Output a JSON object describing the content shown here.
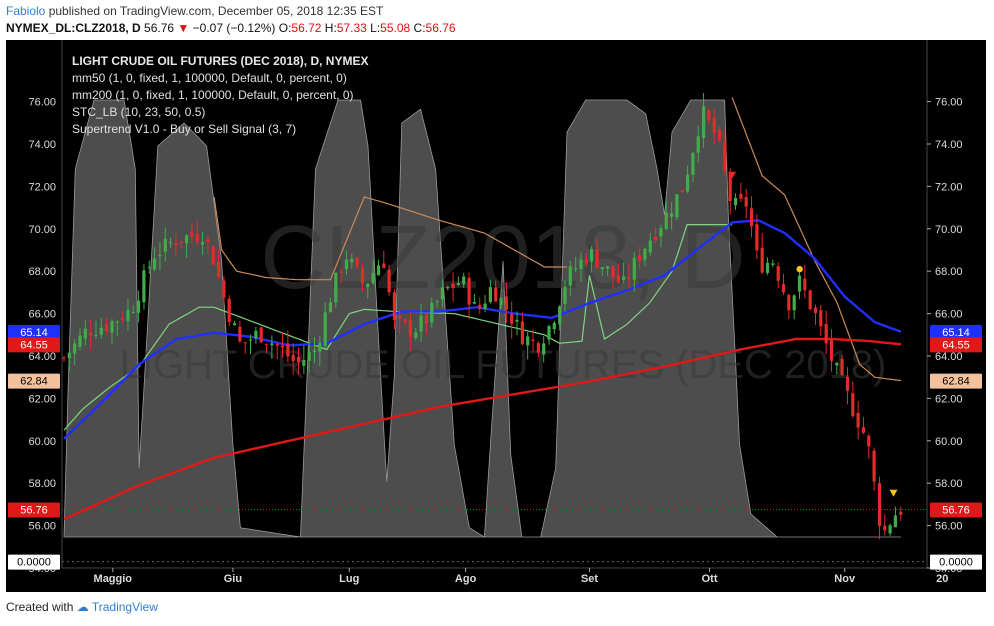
{
  "header": {
    "author": "Fabiolo",
    "published": "published on TradingView.com, December 05, 2018 12:35 EST",
    "symbol": "NYMEX_DL:CLZ2018, D",
    "last": "56.76",
    "change": "−0.07 (−0.12%)",
    "open_label": "O:",
    "open": "56.72",
    "high_label": "H:",
    "high": "57.33",
    "low_label": "L:",
    "low": "55.08",
    "close_label": "C:",
    "close": "56.76"
  },
  "legend": {
    "title": "LIGHT CRUDE OIL FUTURES (DEC 2018), D, NYMEX",
    "line1": "mm50 (1, 0, fixed, 1, 100000, Default, 0, percent, 0)",
    "line2": "mm200 (1, 0, fixed, 1, 100000, Default, 0, percent, 0)",
    "line3": "STC_LB (10, 23, 50, 0.5)",
    "line4": "Supertrend V1.0 - Buy or Sell Signal (3, 7)"
  },
  "watermark": {
    "symbol": "CLZ2018, D",
    "name": "LIGHT CRUDE OIL FUTURES (DEC 2018)"
  },
  "footer": {
    "created_with": "Created with",
    "brand": "TradingView"
  },
  "colors": {
    "background": "#000000",
    "up_candle": "#3fae49",
    "down_candle": "#e8292c",
    "mm50": "#1f2fff",
    "mm200": "#e01818",
    "stc_fill": "#555555",
    "supertrend_up": "#7fd47f",
    "supertrend_down": "#c98a5a"
  },
  "chart_data": {
    "type": "candlestick",
    "y_range": [
      54,
      77
    ],
    "y_ticks": [
      "54.00",
      "56.00",
      "58.00",
      "60.00",
      "62.00",
      "64.00",
      "66.00",
      "68.00",
      "70.00",
      "72.00",
      "74.00",
      "76.00"
    ],
    "x_labels": [
      "Maggio",
      "Giu",
      "Lug",
      "Ago",
      "Set",
      "Ott",
      "Nov",
      "20"
    ],
    "x_label_days": [
      13,
      45,
      76,
      107,
      140,
      172,
      208,
      234
    ],
    "price_labels": {
      "left": [
        {
          "text": "65.14",
          "value": 65.14,
          "color": "#1f2fff"
        },
        {
          "text": "64.55",
          "value": 64.55,
          "color": "#e01818"
        },
        {
          "text": "62.84",
          "value": 62.84,
          "color": "#f3c29c"
        },
        {
          "text": "56.76",
          "value": 56.76,
          "color": "#e01818"
        },
        {
          "text": "0.0000",
          "value": 54.3,
          "color": "#ffffff"
        }
      ],
      "right": [
        {
          "text": "65.14",
          "value": 65.14,
          "color": "#1f2fff"
        },
        {
          "text": "64.55",
          "value": 64.55,
          "color": "#e01818"
        },
        {
          "text": "62.84",
          "value": 62.84,
          "color": "#f3c29c"
        },
        {
          "text": "56.76",
          "value": 56.76,
          "color": "#e01818"
        },
        {
          "text": "0.0000",
          "value": 54.3,
          "color": "#ffffff"
        }
      ]
    },
    "close_key": [
      [
        0,
        63.9
      ],
      [
        6,
        65.2
      ],
      [
        12,
        65.5
      ],
      [
        18,
        66.2
      ],
      [
        24,
        68.8
      ],
      [
        30,
        69.5
      ],
      [
        37,
        69.8
      ],
      [
        40,
        68.5
      ],
      [
        43,
        66.5
      ],
      [
        47,
        64.5
      ],
      [
        52,
        65.1
      ],
      [
        58,
        64.3
      ],
      [
        62,
        63.6
      ],
      [
        67,
        64.3
      ],
      [
        71,
        66.8
      ],
      [
        75,
        68.8
      ],
      [
        80,
        67.3
      ],
      [
        85,
        68.7
      ],
      [
        88,
        65.5
      ],
      [
        93,
        65.2
      ],
      [
        97,
        65.8
      ],
      [
        101,
        67.0
      ],
      [
        106,
        67.6
      ],
      [
        110,
        66.0
      ],
      [
        114,
        67.3
      ],
      [
        118,
        66.2
      ],
      [
        122,
        65.0
      ],
      [
        126,
        64.5
      ],
      [
        130,
        65.6
      ],
      [
        134,
        67.7
      ],
      [
        140,
        68.9
      ],
      [
        145,
        68.0
      ],
      [
        149,
        67.3
      ],
      [
        154,
        69.0
      ],
      [
        160,
        70.5
      ],
      [
        165,
        72.0
      ],
      [
        170,
        75.5
      ],
      [
        174,
        74.3
      ],
      [
        178,
        71.0
      ],
      [
        182,
        71.2
      ],
      [
        185,
        68.3
      ],
      [
        189,
        68.5
      ],
      [
        193,
        66.5
      ],
      [
        196,
        67.5
      ],
      [
        200,
        66.0
      ],
      [
        205,
        63.6
      ],
      [
        209,
        62.0
      ],
      [
        214,
        60.0
      ],
      [
        218,
        55.5
      ],
      [
        221,
        56.5
      ],
      [
        223,
        56.76
      ]
    ],
    "mm50_key": [
      [
        0,
        60.1
      ],
      [
        10,
        61.8
      ],
      [
        20,
        63.6
      ],
      [
        30,
        64.8
      ],
      [
        40,
        65.1
      ],
      [
        50,
        64.9
      ],
      [
        60,
        64.5
      ],
      [
        70,
        64.6
      ],
      [
        80,
        65.5
      ],
      [
        90,
        66.1
      ],
      [
        100,
        66.1
      ],
      [
        110,
        66.3
      ],
      [
        120,
        66.0
      ],
      [
        130,
        65.8
      ],
      [
        140,
        66.5
      ],
      [
        150,
        67.1
      ],
      [
        160,
        67.8
      ],
      [
        170,
        69.2
      ],
      [
        178,
        70.3
      ],
      [
        185,
        70.4
      ],
      [
        192,
        69.8
      ],
      [
        200,
        68.6
      ],
      [
        208,
        66.8
      ],
      [
        216,
        65.6
      ],
      [
        223,
        65.14
      ]
    ],
    "mm200_key": [
      [
        0,
        56.3
      ],
      [
        20,
        57.9
      ],
      [
        40,
        59.2
      ],
      [
        60,
        60.0
      ],
      [
        80,
        60.8
      ],
      [
        100,
        61.6
      ],
      [
        120,
        62.2
      ],
      [
        140,
        62.8
      ],
      [
        160,
        63.5
      ],
      [
        180,
        64.3
      ],
      [
        195,
        64.8
      ],
      [
        205,
        64.8
      ],
      [
        215,
        64.7
      ],
      [
        223,
        64.55
      ]
    ],
    "stc_key": [
      [
        0,
        0
      ],
      [
        1,
        30
      ],
      [
        3,
        80
      ],
      [
        8,
        95
      ],
      [
        16,
        95
      ],
      [
        19,
        80
      ],
      [
        20,
        15
      ],
      [
        21,
        28
      ],
      [
        25,
        85
      ],
      [
        32,
        90
      ],
      [
        38,
        85
      ],
      [
        42,
        60
      ],
      [
        45,
        20
      ],
      [
        47,
        2
      ],
      [
        63,
        0
      ],
      [
        64,
        20
      ],
      [
        67,
        80
      ],
      [
        73,
        95
      ],
      [
        79,
        95
      ],
      [
        81,
        85
      ],
      [
        84,
        40
      ],
      [
        86,
        12
      ],
      [
        88,
        35
      ],
      [
        90,
        90
      ],
      [
        95,
        93
      ],
      [
        99,
        80
      ],
      [
        104,
        20
      ],
      [
        108,
        2
      ],
      [
        112,
        0
      ],
      [
        114,
        25
      ],
      [
        117,
        60
      ],
      [
        119,
        18
      ],
      [
        122,
        0
      ],
      [
        127,
        0
      ],
      [
        131,
        15
      ],
      [
        134,
        88
      ],
      [
        139,
        95
      ],
      [
        150,
        95
      ],
      [
        155,
        92
      ],
      [
        158,
        80
      ],
      [
        160,
        70
      ],
      [
        162,
        88
      ],
      [
        167,
        95
      ],
      [
        176,
        95
      ],
      [
        177,
        70
      ],
      [
        180,
        20
      ],
      [
        183,
        5
      ],
      [
        190,
        0
      ],
      [
        223,
        0
      ]
    ],
    "supertrend_up_key": [
      [
        0,
        60.5
      ],
      [
        5,
        61.5
      ],
      [
        12,
        62.5
      ],
      [
        20,
        63.5
      ],
      [
        28,
        65.5
      ],
      [
        36,
        66.3
      ],
      [
        40,
        66.3
      ],
      [
        70,
        64.3
      ],
      [
        76,
        66.0
      ],
      [
        80,
        66.2
      ],
      [
        88,
        66.1
      ],
      [
        104,
        66.0
      ],
      [
        128,
        65.0
      ],
      [
        132,
        64.6
      ],
      [
        138,
        64.7
      ],
      [
        140,
        67.8
      ],
      [
        144,
        64.8
      ],
      [
        150,
        65.5
      ],
      [
        156,
        66.5
      ],
      [
        162,
        68.0
      ],
      [
        166,
        70.2
      ],
      [
        178,
        70.2
      ]
    ],
    "supertrend_down_key": [
      [
        40,
        71.5
      ],
      [
        42,
        69.0
      ],
      [
        46,
        68.0
      ],
      [
        54,
        67.7
      ],
      [
        62,
        67.6
      ],
      [
        66,
        67.6
      ],
      [
        71,
        67.6
      ],
      [
        80,
        71.5
      ],
      [
        86,
        71.2
      ],
      [
        100,
        70.4
      ],
      [
        112,
        69.8
      ],
      [
        128,
        68.2
      ],
      [
        134,
        68.2
      ],
      [
        178,
        76.2
      ],
      [
        186,
        72.5
      ],
      [
        192,
        71.6
      ],
      [
        200,
        68.5
      ],
      [
        206,
        66.5
      ],
      [
        212,
        63.6
      ],
      [
        216,
        63.0
      ],
      [
        223,
        62.84
      ]
    ],
    "signals": [
      {
        "day": 196,
        "value": 68.1,
        "color": "#f5c518",
        "shape": "dot"
      },
      {
        "day": 221,
        "value": 57.5,
        "color": "#f5c518",
        "shape": "triangle-down"
      },
      {
        "day": 178,
        "value": 72.5,
        "color": "#e8292c",
        "shape": "triangle-down"
      }
    ]
  }
}
